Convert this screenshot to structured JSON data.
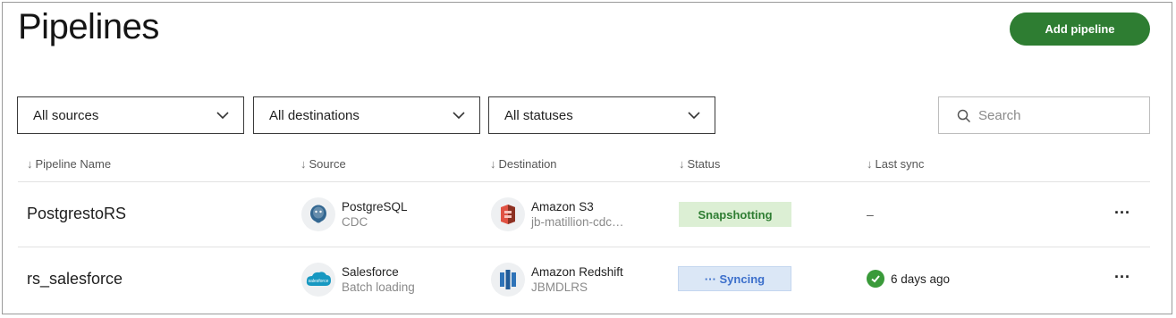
{
  "page": {
    "title": "Pipelines",
    "add_button": "Add pipeline"
  },
  "filters": {
    "sources": "All sources",
    "destinations": "All destinations",
    "statuses": "All statuses"
  },
  "search": {
    "placeholder": "Search"
  },
  "columns": {
    "name": "Pipeline Name",
    "source": "Source",
    "destination": "Destination",
    "status": "Status",
    "last_sync": "Last sync"
  },
  "rows": [
    {
      "name": "PostgrestoRS",
      "source_name": "PostgreSQL",
      "source_sub": "CDC",
      "source_icon": "postgresql-icon",
      "dest_name": "Amazon S3",
      "dest_sub": "jb-matillion-cdc…",
      "dest_icon": "amazon-s3-icon",
      "status": "Snapshotting",
      "last_sync": "–",
      "more": "···"
    },
    {
      "name": "rs_salesforce",
      "source_name": "Salesforce",
      "source_sub": "Batch loading",
      "source_icon": "salesforce-icon",
      "dest_name": "Amazon Redshift",
      "dest_sub": "JBMDLRS",
      "dest_icon": "amazon-redshift-icon",
      "status": "··· Syncing",
      "last_sync": "6 days ago",
      "more": "···"
    }
  ],
  "colors": {
    "brand_green": "#2e7d32",
    "snapshot_bg": "#dcefd4",
    "syncing_bg": "#dbe7f6",
    "syncing_text": "#3c6fcb"
  }
}
